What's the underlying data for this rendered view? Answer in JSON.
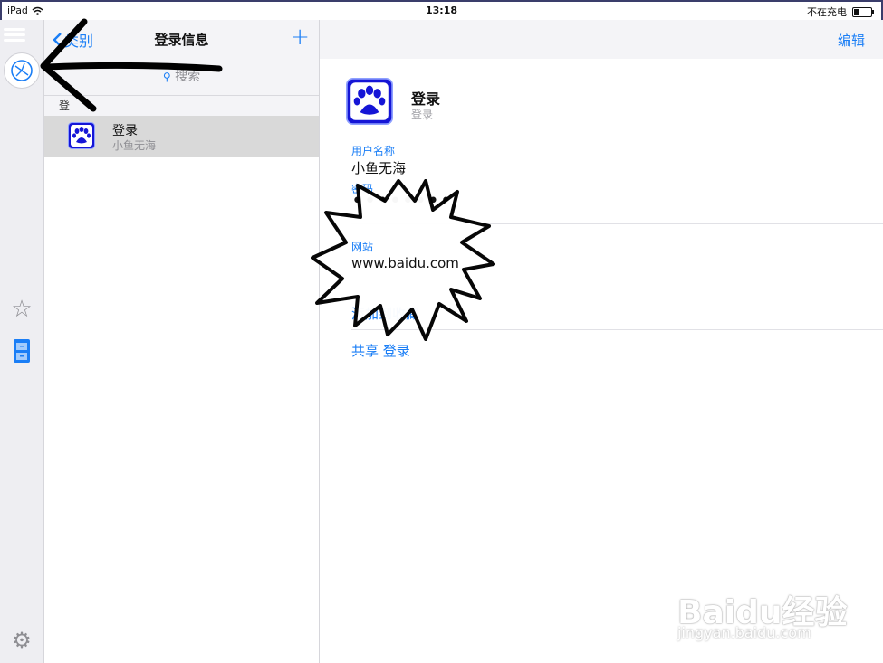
{
  "status": {
    "device": "iPad",
    "time": "13:18",
    "charging": "不在充电"
  },
  "list": {
    "back_label": "类别",
    "title": "登录信息",
    "add_label": "+",
    "search_placeholder": "搜索",
    "section_header": "登",
    "items": [
      {
        "title": "登录",
        "subtitle": "小鱼无海"
      }
    ]
  },
  "detail": {
    "edit_label": "编辑",
    "title": "登录",
    "subtitle": "登录",
    "username_label": "用户名称",
    "username_value": "小鱼无海",
    "password_label": "密码",
    "password_value": "••••••••",
    "website_label": "网站",
    "website_value": "www.baidu.com",
    "favorite_action": "添加到收藏",
    "share_action": "共享 登录"
  },
  "watermark": {
    "text": "Baidu经验",
    "url": "jingyan.baidu.com"
  },
  "colors": {
    "accent": "#1a7ef6",
    "paw_blue": "#1515d6"
  }
}
